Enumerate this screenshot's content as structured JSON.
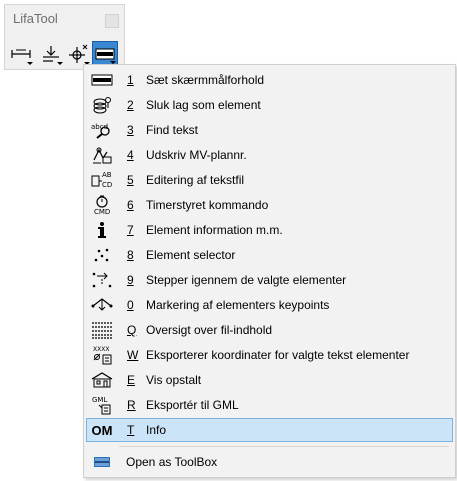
{
  "toolbar": {
    "title": "LifaTool",
    "buttons": [
      {
        "icon": "measure-icon"
      },
      {
        "icon": "level-icon"
      },
      {
        "icon": "move-icon"
      },
      {
        "icon": "toolbox-icon",
        "active": true
      }
    ]
  },
  "menu": {
    "items": [
      {
        "key": "1",
        "label": "Sæt skærmmålforhold",
        "icon": "aspect-ratio-icon"
      },
      {
        "key": "2",
        "label": "Sluk lag som element",
        "icon": "layers-off-icon"
      },
      {
        "key": "3",
        "label": "Find tekst",
        "icon": "find-text-icon"
      },
      {
        "key": "4",
        "label": "Udskriv MV-plannr.",
        "icon": "print-plan-icon"
      },
      {
        "key": "5",
        "label": "Editering af tekstfil",
        "icon": "edit-textfile-icon",
        "icon_text": "AB CD"
      },
      {
        "key": "6",
        "label": "Timerstyret kommando",
        "icon": "timer-command-icon",
        "icon_text": "CMD"
      },
      {
        "key": "7",
        "label": "Element information m.m.",
        "icon": "info-icon"
      },
      {
        "key": "8",
        "label": "Element selector",
        "icon": "element-selector-icon"
      },
      {
        "key": "9",
        "label": "Stepper igennem de valgte elementer",
        "icon": "stepper-icon"
      },
      {
        "key": "0",
        "label": "Markering af elementers keypoints",
        "icon": "keypoints-icon"
      },
      {
        "key": "Q",
        "label": "Oversigt over fil-indhold",
        "icon": "file-overview-icon"
      },
      {
        "key": "W",
        "label": "Eksporterer koordinater for valgte tekst elementer",
        "icon": "export-coords-icon",
        "icon_text": "XXXX"
      },
      {
        "key": "E",
        "label": "Vis opstalt",
        "icon": "elevation-icon"
      },
      {
        "key": "R",
        "label": "Eksportér til GML",
        "icon": "export-gml-icon",
        "icon_text": "GML"
      },
      {
        "key": "T",
        "label": "Info",
        "icon": "om-icon",
        "icon_text": "OM",
        "highlighted": true
      }
    ],
    "footer_item": {
      "label": "Open as ToolBox",
      "icon": "toolbox-icon"
    }
  },
  "colors": {
    "accent": "#3a88d4",
    "highlight_bg": "#cce4f7",
    "highlight_border": "#7ab3e3"
  }
}
